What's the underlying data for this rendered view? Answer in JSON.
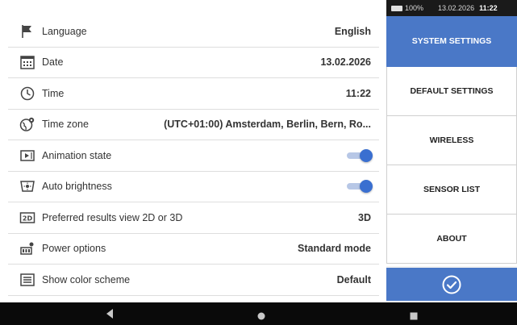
{
  "status_bar": {
    "battery": "100%",
    "date": "13.02.2026",
    "time": "11:22"
  },
  "settings": [
    {
      "icon": "flag-icon",
      "label": "Language",
      "value": "English",
      "kind": "value"
    },
    {
      "icon": "calendar-icon",
      "label": "Date",
      "value": "13.02.2026",
      "kind": "value"
    },
    {
      "icon": "clock-icon",
      "label": "Time",
      "value": "11:22",
      "kind": "value"
    },
    {
      "icon": "globe-icon",
      "label": "Time zone",
      "value": "(UTC+01:00) Amsterdam, Berlin, Bern, Ro...",
      "kind": "value"
    },
    {
      "icon": "animation-icon",
      "label": "Animation state",
      "value": "on",
      "kind": "toggle"
    },
    {
      "icon": "brightness-icon",
      "label": "Auto brightness",
      "value": "on",
      "kind": "toggle"
    },
    {
      "icon": "2d-icon",
      "label": "Preferred results view 2D or 3D",
      "value": "3D",
      "kind": "value"
    },
    {
      "icon": "power-options-icon",
      "label": "Power options",
      "value": "Standard mode",
      "kind": "value"
    },
    {
      "icon": "color-scheme-icon",
      "label": "Show color scheme",
      "value": "Default",
      "kind": "value"
    }
  ],
  "menu": {
    "items": [
      {
        "label": "SYSTEM SETTINGS",
        "active": true
      },
      {
        "label": "DEFAULT SETTINGS",
        "active": false
      },
      {
        "label": "WIRELESS",
        "active": false
      },
      {
        "label": "SENSOR LIST",
        "active": false
      },
      {
        "label": "ABOUT",
        "active": false
      }
    ],
    "confirm_icon": "check-circle-icon"
  },
  "nav": {
    "back_icon": "back-triangle-icon",
    "home_icon": "home-circle-icon",
    "recents_icon": "recents-square-icon"
  },
  "colors": {
    "accent": "#4a78c7",
    "toggle_thumb": "#3a6fd0"
  }
}
